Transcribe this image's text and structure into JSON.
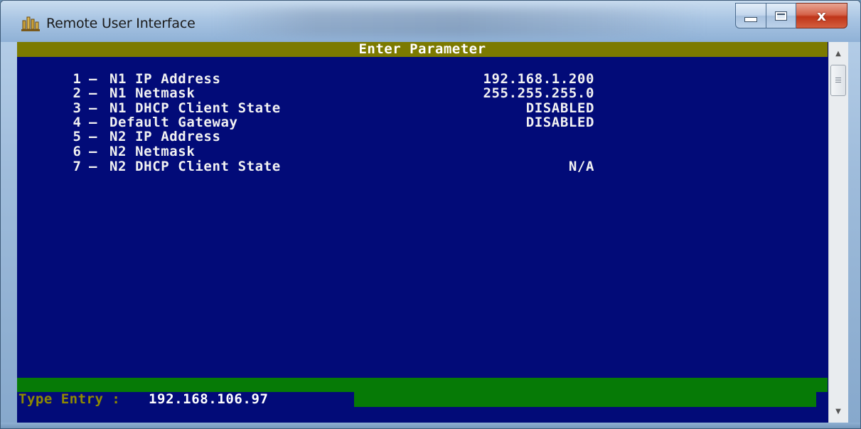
{
  "window": {
    "title": "Remote User Interface",
    "close_glyph": "x",
    "icon": "building-icon"
  },
  "terminal": {
    "header": "Enter Parameter",
    "params": [
      {
        "num": "1",
        "label": "N1 IP Address",
        "value": "192.168.1.200"
      },
      {
        "num": "2",
        "label": "N1 Netmask",
        "value": "255.255.255.0"
      },
      {
        "num": "3",
        "label": "N1 DHCP Client State",
        "value": "DISABLED"
      },
      {
        "num": "4",
        "label": "Default Gateway",
        "value": "DISABLED"
      },
      {
        "num": "5",
        "label": "N2 IP Address",
        "value": ""
      },
      {
        "num": "6",
        "label": "N2 Netmask",
        "value": ""
      },
      {
        "num": "7",
        "label": "N2 DHCP Client State",
        "value": "N/A"
      }
    ],
    "entry_label": "Type Entry :",
    "entry_value": "192.168.106.97"
  },
  "colors": {
    "terminal_bg": "#020b78",
    "header_bg": "#7c7a00",
    "entry_bar": "#067a06",
    "entry_label": "#8f8b00"
  }
}
